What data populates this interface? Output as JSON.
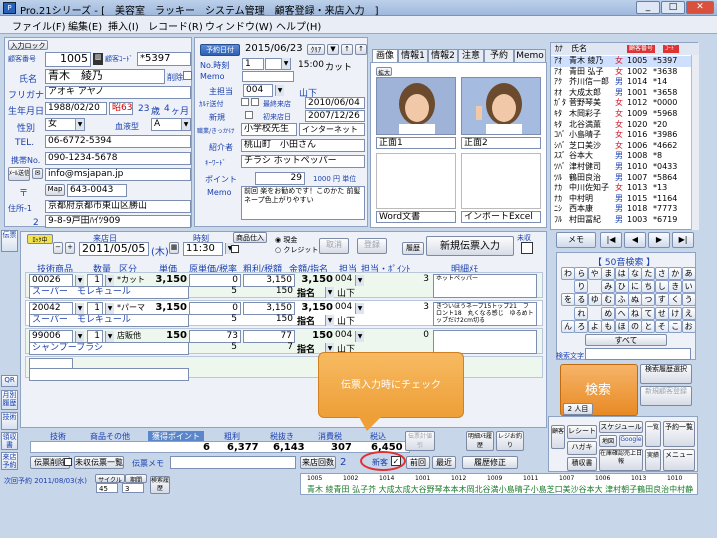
{
  "title": {
    "app": "Pro.21シリーズ",
    "sub": "- [　美容室　ラッキー　システム管理　顧客登録・来店入力　]",
    "icon": "P"
  },
  "menu": [
    "ファイル(F)",
    "編集(E)",
    "挿入(I)",
    "レコード(R)",
    "ウィンドウ(W)",
    "ヘルプ(H)"
  ],
  "customer": {
    "entry_btn": "入力ロック",
    "no_label": "顧客番号",
    "no": "1005",
    "code_label": "顧客ｺｰﾄﾞ",
    "code": "*5397",
    "name_label": "氏名",
    "name": "青木　綾乃",
    "del_label": "削除",
    "kana_label": "フリガナ",
    "kana": "アオキ アヤノ",
    "birth_label": "生年月日",
    "birth": "1988/02/20",
    "era": "昭63",
    "age": "23",
    "age_unit": "歳",
    "months": "4",
    "months_unit": "ヶ月",
    "sex_label": "性別",
    "sex": "女",
    "blood_label": "血液型",
    "blood": "A",
    "tel_label": "TEL.",
    "tel": "06-6772-5394",
    "mobile_label": "携帯No.",
    "mobile": "090-1234-5678",
    "mail_label": "ﾒｰﾙ送信",
    "mail": "info@msjapan.jp",
    "zip_label": "〒",
    "map_btn": "Map",
    "zip": "643-0043",
    "addr_label": "住所-1",
    "addr1": "京都府京都市東山区勝山",
    "addr2_label": "2",
    "addr2": "9-8-9戸田ﾊｲﾂ909"
  },
  "visit": {
    "date_btn": "予約日付",
    "date": "2015/06/23",
    "clear": "ｸﾘｱ",
    "time_label": "No.時刻",
    "time_no": "1",
    "time": "15:00",
    "menu_item": "カット",
    "memo_label": "Memo",
    "staff_label": "主担当",
    "staff_code": "004",
    "staff_name": "山下",
    "last_label": "ｶﾙﾃ送付",
    "last_visit_label": "最終来店",
    "last_visit": "2010/06/04",
    "new_label": "新規",
    "first_label": "初来店日",
    "first_visit": "2007/12/26",
    "job_label": "職業/きっかけ",
    "job": "小学校先生",
    "trigger": "インターネット",
    "intro_label": "紹介者",
    "intro": "桃山町　小田さん",
    "kw_label": "ｷｰﾜｰﾄﾞ",
    "kw": "チラシ ホットペッパー",
    "point_label": "ポイント",
    "point": "29",
    "point_unit": "1000 円 単位",
    "memo": "前回 楽をお勧めです！このかた 前髪 ネープ色上がりやすい"
  },
  "tabs": [
    "画像",
    "情報1",
    "情報2",
    "注意",
    "予約",
    "Memo"
  ],
  "image": {
    "enlarge": "拡大",
    "front1": "正面1",
    "front2": "正面2",
    "word": "Word文書",
    "excel": "インポートExcel"
  },
  "list": {
    "header": [
      "ｶﾅ",
      "氏名",
      "顧客番号",
      "ｺｰﾄﾞ"
    ],
    "rows": [
      [
        "ｱｵ",
        "青木 綾乃",
        "女",
        "1005",
        "*5397"
      ],
      [
        "ｱｵ",
        "青田 弘子",
        "女",
        "1002",
        "*3638"
      ],
      [
        "ｱｸ",
        "芥川信一郎",
        "男",
        "1014",
        "*14"
      ],
      [
        "ｵｵ",
        "大成太郎",
        "男",
        "1001",
        "*3658"
      ],
      [
        "ｶﾞﾀ",
        "菅野琴美",
        "女",
        "1012",
        "*0000"
      ],
      [
        "ｷﾀ",
        "木岡彩子",
        "女",
        "1009",
        "*5968"
      ],
      [
        "ｷﾀ",
        "北谷満薫",
        "女",
        "1020",
        "*20"
      ],
      [
        "ｺﾊﾞ",
        "小島晴子",
        "女",
        "1016",
        "*3986"
      ],
      [
        "ｼﾊﾞ",
        "芝口美沙",
        "女",
        "1006",
        "*4662"
      ],
      [
        "ｽｽﾞ",
        "谷本大",
        "男",
        "1008",
        "*8"
      ],
      [
        "ﾂﾊﾞ",
        "津村健司",
        "男",
        "1010",
        "*0433"
      ],
      [
        "ﾂﾙ",
        "鶴田良治",
        "男",
        "1007",
        "*5864"
      ],
      [
        "ﾅｶ",
        "中川佐知子",
        "女",
        "1013",
        "*13"
      ],
      [
        "ﾅｶ",
        "中村明",
        "男",
        "1015",
        "*1164"
      ],
      [
        "ﾆｼ",
        "西本康",
        "男",
        "1018",
        "*7773"
      ],
      [
        "ﾌﾙ",
        "村田冨紀",
        "男",
        "1003",
        "*6719"
      ]
    ]
  },
  "nav": {
    "memo": "メモ",
    "first": "|◀",
    "prev": "◀",
    "next": "▶",
    "last": "▶|"
  },
  "kana": {
    "title": "【 50音検索 】",
    "rows": [
      [
        "わ",
        "ら",
        "や",
        "ま",
        "は",
        "な",
        "た",
        "さ",
        "か",
        "あ"
      ],
      [
        "",
        "り",
        "",
        "み",
        "ひ",
        "に",
        "ち",
        "し",
        "き",
        "い"
      ],
      [
        "を",
        "る",
        "ゆ",
        "む",
        "ふ",
        "ぬ",
        "つ",
        "す",
        "く",
        "う"
      ],
      [
        "",
        "れ",
        "",
        "め",
        "へ",
        "ね",
        "て",
        "せ",
        "け",
        "え"
      ],
      [
        "ん",
        "ろ",
        "よ",
        "も",
        "ほ",
        "の",
        "と",
        "そ",
        "こ",
        "お"
      ]
    ],
    "all": "すべて",
    "search_text_label": "検索文字"
  },
  "search": {
    "btn": "検索",
    "count": "2 人目",
    "hist": "検索履歴選択",
    "new_reg": "新規顧客登録"
  },
  "bottom_right": {
    "receipt": "レシート",
    "schedule": "スケジュール",
    "kokyaku": "顧客",
    "list": "一覧",
    "hagaki": "ハガキ",
    "google": "Google",
    "map": "地図",
    "calendar": "予約一覧",
    "zaiko": "積収書",
    "sales": "在庫確認売上日報",
    "rec": "実績",
    "menu_btn": "メニュー"
  },
  "sales": {
    "slip_btn": "ﾛｯｸ中",
    "date_label": "来店日",
    "date": "2011/05/05",
    "wday": "(木)",
    "time_label": "時刻",
    "time": "11:30",
    "goods_btn": "商品仕入",
    "cash": "現金",
    "credit": "クレジット",
    "cancel": "取消",
    "register": "登録",
    "hist": "履歴",
    "new_slip": "新規伝票入力",
    "unclosed": "未収",
    "cols": [
      "技術商品",
      "数量",
      "区分",
      "単価",
      "原単価/税率",
      "粗利/税額",
      "金額/指名",
      "担当",
      "担当・ﾎﾟｲﾝﾄ",
      "明細ﾒﾓ"
    ],
    "rows": [
      {
        "code": "00026",
        "qty": "1",
        "kubun": "*カット",
        "price": "3,150",
        "cost": "0",
        "gross": "3,150",
        "amount": "3,150",
        "staff_code": "004",
        "pt": "3",
        "memo": "ホットペッパー",
        "name": "スーパー　モレキュール",
        "cost2": "5",
        "tax": "150",
        "shimei": "指名",
        "staff": "山下"
      },
      {
        "code": "20042",
        "qty": "1",
        "kubun": "*パーマ",
        "price": "3,150",
        "cost": "0",
        "gross": "3,150",
        "amount": "3,150",
        "staff_code": "004",
        "pt": "3",
        "memo": "きついほうネープ15トップ21　フロント18　丸くなる感じ　ゆるめトップだけ2cm切る",
        "name": "スーパー　モレキュール",
        "cost2": "5",
        "tax": "150",
        "shimei": "指名",
        "staff": "山下"
      },
      {
        "code": "99006",
        "qty": "1",
        "kubun": "店販他",
        "price": "150",
        "cost": "73",
        "gross": "77",
        "amount": "150",
        "staff_code": "004",
        "pt": "0",
        "memo": "",
        "name": "シャンプーブラシ",
        "cost2": "5",
        "tax": "7",
        "shimei": "指名",
        "staff": "山下"
      }
    ],
    "totals": {
      "tech_label": "技術",
      "goods_label": "商品その他",
      "pt_label": "獲得ポイント",
      "pt": "6",
      "gross_label": "粗利",
      "gross": "6,377",
      "net_label": "税抜き",
      "net": "6,143",
      "tax_label": "消費税",
      "tax": "307",
      "total_label": "税込",
      "total": "6,450",
      "round": "伝票計値引"
    },
    "detail_btn": "明細ﾒﾓ履歴",
    "receipt_btn": "レジお釣り",
    "slip_del": "伝票削除",
    "unpaid_list": "未収伝票一覧",
    "slip_memo": "伝票メモ",
    "visits_label": "来店回数",
    "visits": "2",
    "newbie": "新客",
    "prev": "前回",
    "latest": "最近",
    "hist_fix": "履歴修正",
    "next_label": "次回予約",
    "next": "2011/08/03(水)",
    "cycle": "サイクル",
    "interval": "期間",
    "c1": "45",
    "c2": "3",
    "recheck": "検索履歴"
  },
  "side": [
    "伝票",
    "QR",
    "月別履歴",
    "技術",
    "領収書",
    "来店予約"
  ],
  "ticker": "青木 綾青田 弘子芥 大成太成大谷野琴本本木岡北谷満小島晴子小島芝口美沙谷本大 津村朝子鶴田良治中村静",
  "ticker_nos": [
    "1005",
    "1002",
    "1014",
    "1001",
    "1012",
    "1009",
    "1011",
    "1007",
    "1006",
    "1013",
    "1010"
  ],
  "callout": "伝票入力時にチェック",
  "colors": {
    "accent": "#2f5fb0",
    "callout": "#ef9b2d",
    "highlight": "#e03030"
  }
}
